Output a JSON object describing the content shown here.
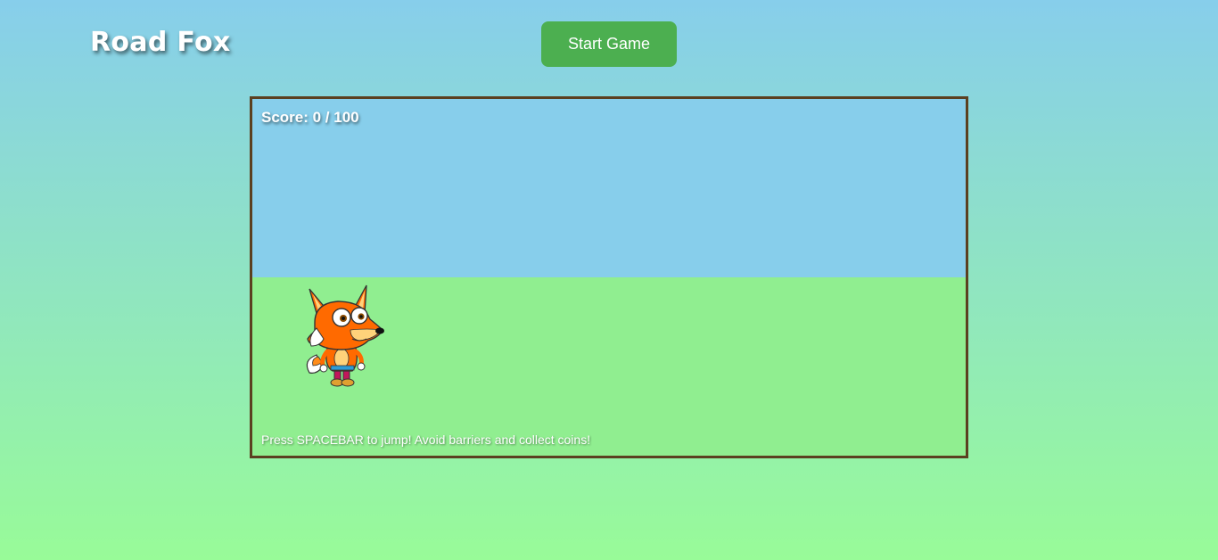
{
  "app": {
    "title": "Road Fox"
  },
  "controls": {
    "start_label": "Start Game"
  },
  "game": {
    "score_text": "Score: 0 / 100",
    "instructions": "Press SPACEBAR to jump! Avoid barriers and collect coins!",
    "colors": {
      "sky": "#87ceeb",
      "ground": "#90ee90",
      "border": "#5b4020",
      "button": "#4caf50"
    },
    "player_icon": "fox-character-icon"
  }
}
